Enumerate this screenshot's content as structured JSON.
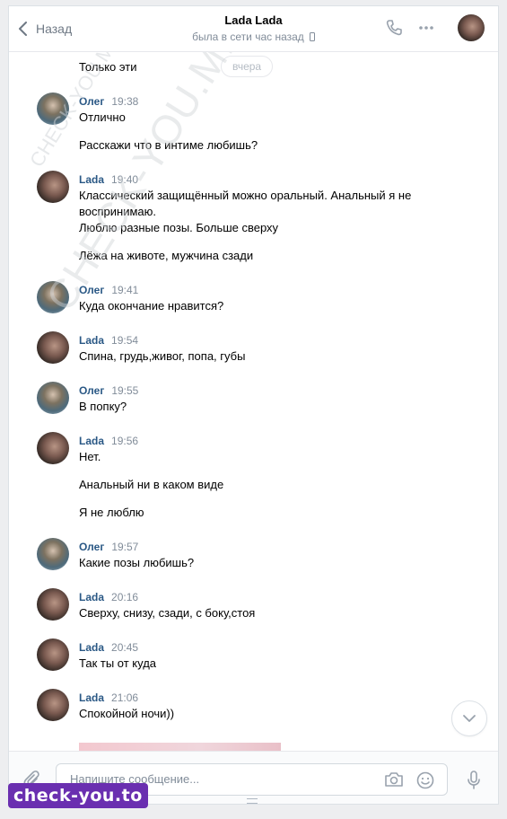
{
  "header": {
    "back_label": "Назад",
    "title": "Lada Lada",
    "status": "была в сети час назад"
  },
  "date_divider": "вчера",
  "messages": {
    "m0": {
      "text": "Только эти"
    },
    "m1": {
      "name": "Олег",
      "time": "19:38",
      "lines": [
        "Отлично",
        "Расскажи что в интиме любишь?"
      ]
    },
    "m2": {
      "name": "Lada",
      "time": "19:40",
      "lines": [
        "Классический защищённый можно оральный. Анальный я не",
        "воспринимаю.",
        "Люблю разные позы. Больше сверху",
        "Лёжа на животе, мужчина сзади"
      ]
    },
    "m3": {
      "name": "Олег",
      "time": "19:41",
      "lines": [
        "Куда окончание нравится?"
      ]
    },
    "m4": {
      "name": "Lada",
      "time": "19:54",
      "lines": [
        "Спина, грудь,живог, попа, губы"
      ]
    },
    "m5": {
      "name": "Олег",
      "time": "19:55",
      "lines": [
        "В попку?"
      ]
    },
    "m6": {
      "name": "Lada",
      "time": "19:56",
      "lines": [
        "Нет.",
        "Анальный ни в каком виде",
        "Я не люблю"
      ]
    },
    "m7": {
      "name": "Олег",
      "time": "19:57",
      "lines": [
        "Какие позы любишь?"
      ]
    },
    "m8": {
      "name": "Lada",
      "time": "20:16",
      "lines": [
        "Сверху, снизу, сзади, с боку,стоя"
      ]
    },
    "m9": {
      "name": "Lada",
      "time": "20:45",
      "lines": [
        "Так ты от куда"
      ]
    },
    "m10": {
      "name": "Lada",
      "time": "21:06",
      "lines": [
        "Спокойной ночи))"
      ]
    }
  },
  "composer": {
    "placeholder": "Напишите сообщение..."
  },
  "watermarks": {
    "large": "CHECK-YOU.ME",
    "small": "CHECK-YOU.ME",
    "badge": "check-you.to"
  },
  "icons": {
    "back": "chevron-left-icon",
    "call": "phone-icon",
    "more": "more-dots-icon",
    "scroll": "chevron-down-icon",
    "attach": "paperclip-icon",
    "camera": "camera-icon",
    "emoji": "smile-icon",
    "mic": "microphone-icon"
  },
  "colors": {
    "name": "#2a5885",
    "time": "#818c99",
    "badge": "#6a2fb0"
  }
}
